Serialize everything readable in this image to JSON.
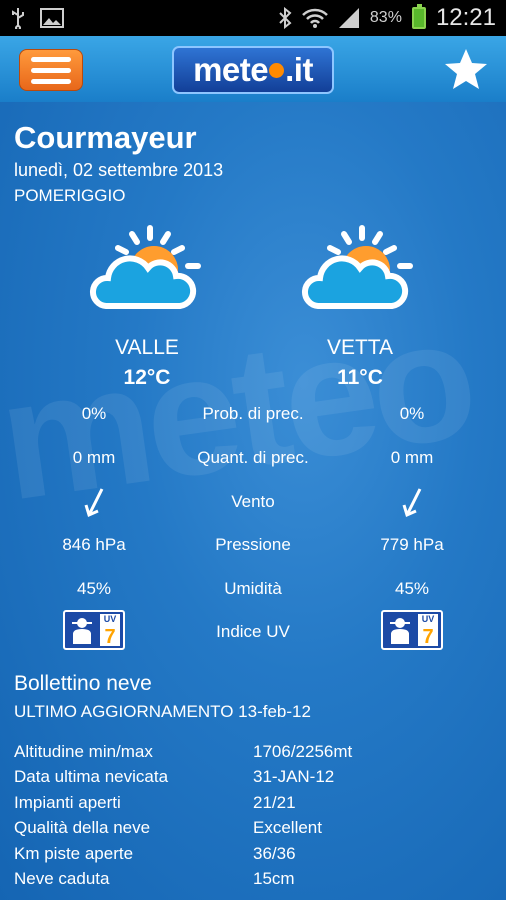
{
  "status": {
    "battery": "83%",
    "time": "12:21"
  },
  "app": {
    "logo": {
      "text_a": "mete",
      "text_b": ".it"
    }
  },
  "location": {
    "city": "Courmayeur",
    "date": "lunedì, 02 settembre 2013",
    "period": "POMERIGGIO"
  },
  "forecast": {
    "valle": {
      "label": "VALLE",
      "temp": "12°C",
      "prob": "0%",
      "quant": "0 mm",
      "pressure": "846 hPa",
      "humidity": "45%",
      "uv": "7"
    },
    "vetta": {
      "label": "VETTA",
      "temp": "11°C",
      "prob": "0%",
      "quant": "0 mm",
      "pressure": "779 hPa",
      "humidity": "45%",
      "uv": "7"
    },
    "labels": {
      "prob": "Prob. di prec.",
      "quant": "Quant. di prec.",
      "wind": "Vento",
      "pressure": "Pressione",
      "humidity": "Umidità",
      "uv": "Indice UV"
    },
    "uv_badge_text": "UV"
  },
  "snow": {
    "title": "Bollettino neve",
    "updated": "ULTIMO AGGIORNAMENTO 13-feb-12",
    "rows": [
      {
        "label": "Altitudine min/max",
        "value": "1706/2256mt"
      },
      {
        "label": "Data ultima nevicata",
        "value": "31-JAN-12"
      },
      {
        "label": "Impianti aperti",
        "value": "21/21"
      },
      {
        "label": "Qualità della neve",
        "value": "Excellent"
      },
      {
        "label": "Km piste aperte",
        "value": "36/36"
      },
      {
        "label": "Neve caduta",
        "value": "15cm"
      }
    ]
  },
  "icons": {
    "menu": "menu-icon",
    "star": "star-icon",
    "weather": "partly-cloudy-icon",
    "wind": "wind-arrow-icon",
    "uv": "uv-index-icon"
  }
}
